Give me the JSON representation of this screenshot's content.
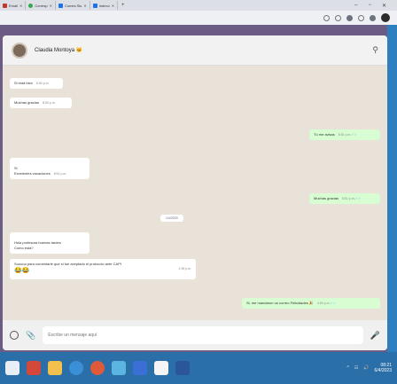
{
  "browser": {
    "tabs": [
      {
        "label": "Email",
        "color": "#c0392b"
      },
      {
        "label": "Corresp",
        "color": "#34a853"
      },
      {
        "label": "Comes Sis",
        "color": "#1a73e8"
      },
      {
        "label": "Indexo",
        "color": "#1a73e8"
      }
    ],
    "new_tab": "+",
    "window": {
      "minimize": "–",
      "restore": "−",
      "close": "✕"
    }
  },
  "chat": {
    "contact": {
      "name": "Claudia Montoya 🐱"
    },
    "messages": [
      {
        "dir": "in",
        "text": "Si está bien",
        "time": "8:50 p.m."
      },
      {
        "dir": "in",
        "text": "Muchas gracias",
        "time": "8:50 p.m."
      },
      {
        "dir": "out",
        "text": "Tú me avisas",
        "time": "8:51 p.m."
      },
      {
        "dir": "in",
        "text": "Si\nExcelentes vacaciones",
        "time": "8:51 p.m."
      },
      {
        "dir": "out",
        "text": "Muchas gracias",
        "time": "8:51 p.m."
      },
      {
        "dir": "in",
        "text": "Hola profesora buenas tardes\nComo está?",
        "time": ""
      },
      {
        "dir": "in",
        "text": "Sooooo para comentarle que si fue aceptado el protocolo ante CAPI",
        "time": "1:39 p.m.",
        "emoji": "😂😂"
      },
      {
        "dir": "out",
        "text": "Si, me mandaron un correo Felicidades 🎉",
        "time": "4:00 p.m."
      }
    ],
    "day_chip": "1/4/2023",
    "composer": {
      "placeholder": "Escribe un mensaje aquí"
    }
  },
  "taskbar": {
    "apps": [
      "start",
      "search",
      "files",
      "edge",
      "chrome",
      "store",
      "mail",
      "calendar",
      "word"
    ],
    "app_colors": [
      "#e8eef5",
      "#d4483b",
      "#f2c04d",
      "#3a8fd6",
      "#e05a3a",
      "#5bb5e0",
      "#3a6fd6",
      "#f5f5f5",
      "#2b579a"
    ],
    "clock_time": "08:21",
    "clock_date": "6/4/2023"
  },
  "colors": {
    "accent": "#25d366",
    "bubble_out": "#d9fdd3",
    "wallpaper": "#6b5c85"
  }
}
